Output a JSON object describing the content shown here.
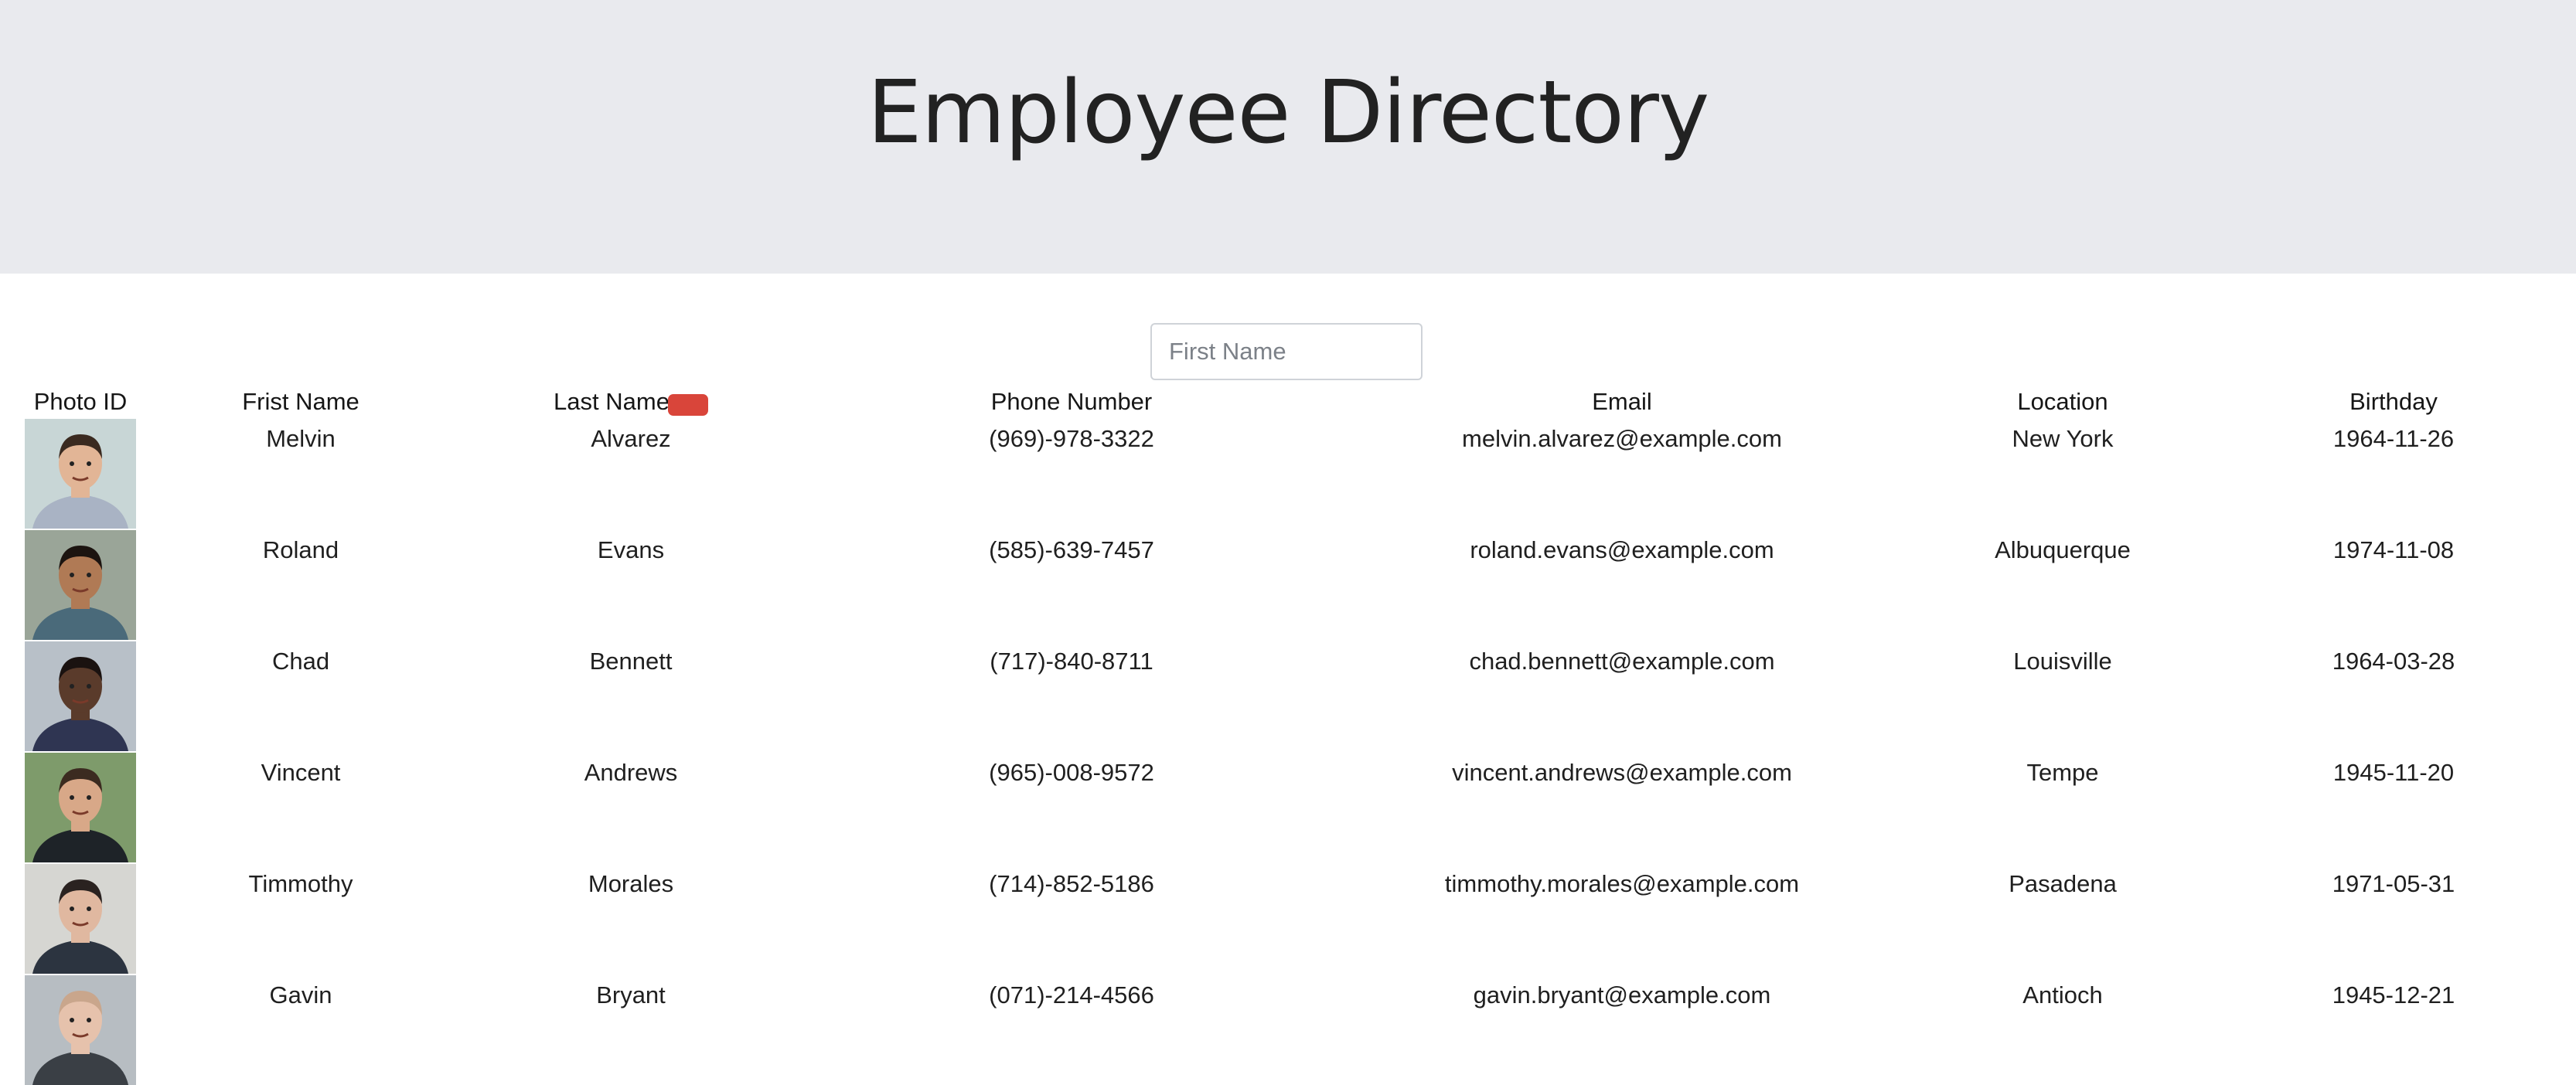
{
  "header": {
    "title": "Employee Directory"
  },
  "search": {
    "placeholder": "First Name",
    "value": ""
  },
  "table": {
    "columns": {
      "photo": "Photo ID",
      "first": "Frist Name",
      "last": "Last Name",
      "phone": "Phone Number",
      "email": "Email",
      "location": "Location",
      "birthday": "Birthday"
    },
    "rows": [
      {
        "first": "Melvin",
        "last": "Alvarez",
        "phone": "(969)-978-3322",
        "email": "melvin.alvarez@example.com",
        "location": "New York",
        "birthday": "1964-11-26",
        "photo_icon": "person-photo"
      },
      {
        "first": "Roland",
        "last": "Evans",
        "phone": "(585)-639-7457",
        "email": "roland.evans@example.com",
        "location": "Albuquerque",
        "birthday": "1974-11-08",
        "photo_icon": "person-photo"
      },
      {
        "first": "Chad",
        "last": "Bennett",
        "phone": "(717)-840-8711",
        "email": "chad.bennett@example.com",
        "location": "Louisville",
        "birthday": "1964-03-28",
        "photo_icon": "person-photo"
      },
      {
        "first": "Vincent",
        "last": "Andrews",
        "phone": "(965)-008-9572",
        "email": "vincent.andrews@example.com",
        "location": "Tempe",
        "birthday": "1945-11-20",
        "photo_icon": "person-photo"
      },
      {
        "first": "Timmothy",
        "last": "Morales",
        "phone": "(714)-852-5186",
        "email": "timmothy.morales@example.com",
        "location": "Pasadena",
        "birthday": "1971-05-31",
        "photo_icon": "person-photo"
      },
      {
        "first": "Gavin",
        "last": "Bryant",
        "phone": "(071)-214-4566",
        "email": "gavin.bryant@example.com",
        "location": "Antioch",
        "birthday": "1945-12-21",
        "photo_icon": "person-photo"
      }
    ]
  },
  "icons": {
    "sort": "sort-icon"
  },
  "colors": {
    "header_bg": "#e9eaee",
    "sort_accent": "#d9453a"
  }
}
